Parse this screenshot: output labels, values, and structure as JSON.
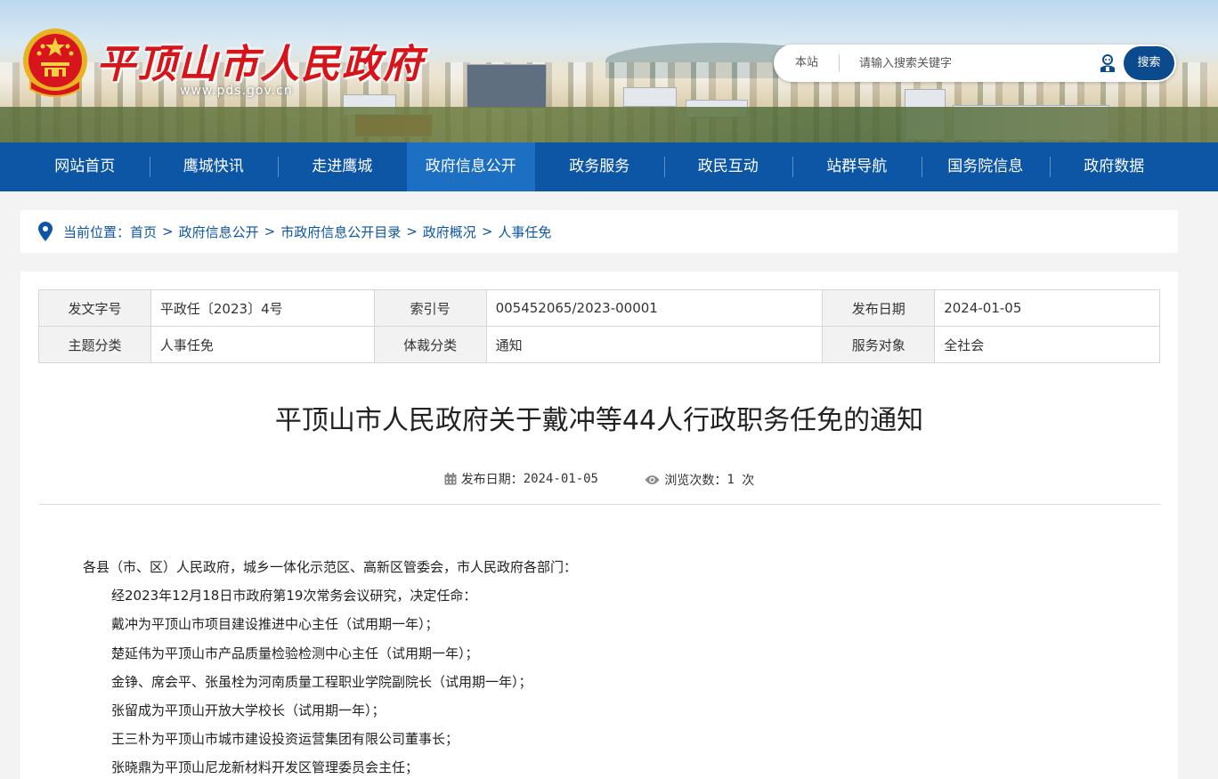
{
  "header": {
    "site_title": "平顶山市人民政府",
    "site_url": "www.pds.gov.cn",
    "search": {
      "scope": "本站",
      "placeholder": "请输入搜索关键字",
      "button": "搜索"
    }
  },
  "nav": {
    "items": [
      {
        "label": "网站首页"
      },
      {
        "label": "鹰城快讯"
      },
      {
        "label": "走进鹰城"
      },
      {
        "label": "政府信息公开"
      },
      {
        "label": "政务服务"
      },
      {
        "label": "政民互动"
      },
      {
        "label": "站群导航"
      },
      {
        "label": "国务院信息"
      },
      {
        "label": "政府数据"
      }
    ],
    "active_index": 3
  },
  "breadcrumb": {
    "label": "当前位置：",
    "items": [
      "首页",
      "政府信息公开",
      "市政府信息公开目录",
      "政府概况",
      "人事任免"
    ],
    "separator": ">"
  },
  "meta": {
    "rows": [
      [
        {
          "k": "发文字号",
          "v": "平政任〔2023〕4号"
        },
        {
          "k": "索引号",
          "v": "005452065/2023-00001"
        },
        {
          "k": "发布日期",
          "v": "2024-01-05"
        }
      ],
      [
        {
          "k": "主题分类",
          "v": "人事任免"
        },
        {
          "k": "体裁分类",
          "v": "通知"
        },
        {
          "k": "服务对象",
          "v": "全社会"
        }
      ]
    ]
  },
  "article": {
    "title": "平顶山市人民政府关于戴冲等44人行政职务任免的通知",
    "date_label": "发布日期：",
    "date": "2024-01-05",
    "views_label": "浏览次数：",
    "views": "1",
    "views_unit": " 次",
    "paragraphs": [
      "各县（市、区）人民政府，城乡一体化示范区、高新区管委会，市人民政府各部门：",
      "经2023年12月18日市政府第19次常务会议研究，决定任命：",
      "戴冲为平顶山市项目建设推进中心主任（试用期一年）；",
      "楚延伟为平顶山市产品质量检验检测中心主任（试用期一年）；",
      "金铮、席会平、张虽栓为河南质量工程职业学院副院长（试用期一年）；",
      "张留成为平顶山开放大学校长（试用期一年）；",
      "王三朴为平顶山市城市建设投资运营集团有限公司董事长；",
      "张晓鼎为平顶山尼龙新材料开发区管理委员会主任；"
    ]
  },
  "colors": {
    "nav_bg": "#0d56a6",
    "nav_active": "#1d6fc3",
    "title_red": "#d6141a",
    "link_blue": "#0d56a6"
  }
}
